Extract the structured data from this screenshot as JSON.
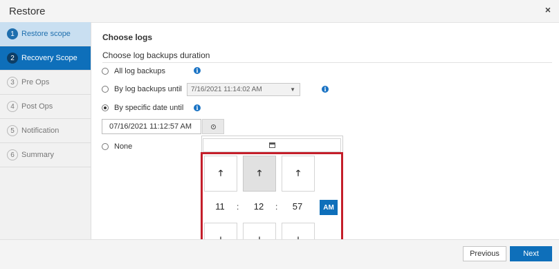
{
  "window": {
    "title": "Restore",
    "close_glyph": "×"
  },
  "sidebar": {
    "steps": [
      {
        "number": "1",
        "label": "Restore scope",
        "state": "done"
      },
      {
        "number": "2",
        "label": "Recovery Scope",
        "state": "active"
      },
      {
        "number": "3",
        "label": "Pre Ops",
        "state": "pending"
      },
      {
        "number": "4",
        "label": "Post Ops",
        "state": "pending"
      },
      {
        "number": "5",
        "label": "Notification",
        "state": "pending"
      },
      {
        "number": "6",
        "label": "Summary",
        "state": "pending"
      }
    ]
  },
  "main": {
    "heading": "Choose logs",
    "subheading": "Choose log backups duration",
    "options": {
      "all_logs": {
        "label": "All log backups",
        "selected": false
      },
      "until_backup": {
        "label": "By log backups until",
        "selected": false,
        "select_value": "7/16/2021 11:14:02 AM"
      },
      "specific_date": {
        "label": "By specific date until",
        "selected": true,
        "date_value": "07/16/2021 11:12:57 AM"
      },
      "none": {
        "label": "None",
        "selected": false
      }
    },
    "info_glyph": "i"
  },
  "time_picker": {
    "hours": "11",
    "minutes": "12",
    "seconds": "57",
    "separator": ":",
    "period": "AM",
    "up_glyph": "🡑",
    "down_glyph": "🡓",
    "active_column": "minutes"
  },
  "footer": {
    "previous_label": "Previous",
    "next_label": "Next"
  },
  "colors": {
    "accent": "#0e6fba",
    "highlight_border": "#c41e2a",
    "completed_step_bg": "#c9dff1"
  }
}
